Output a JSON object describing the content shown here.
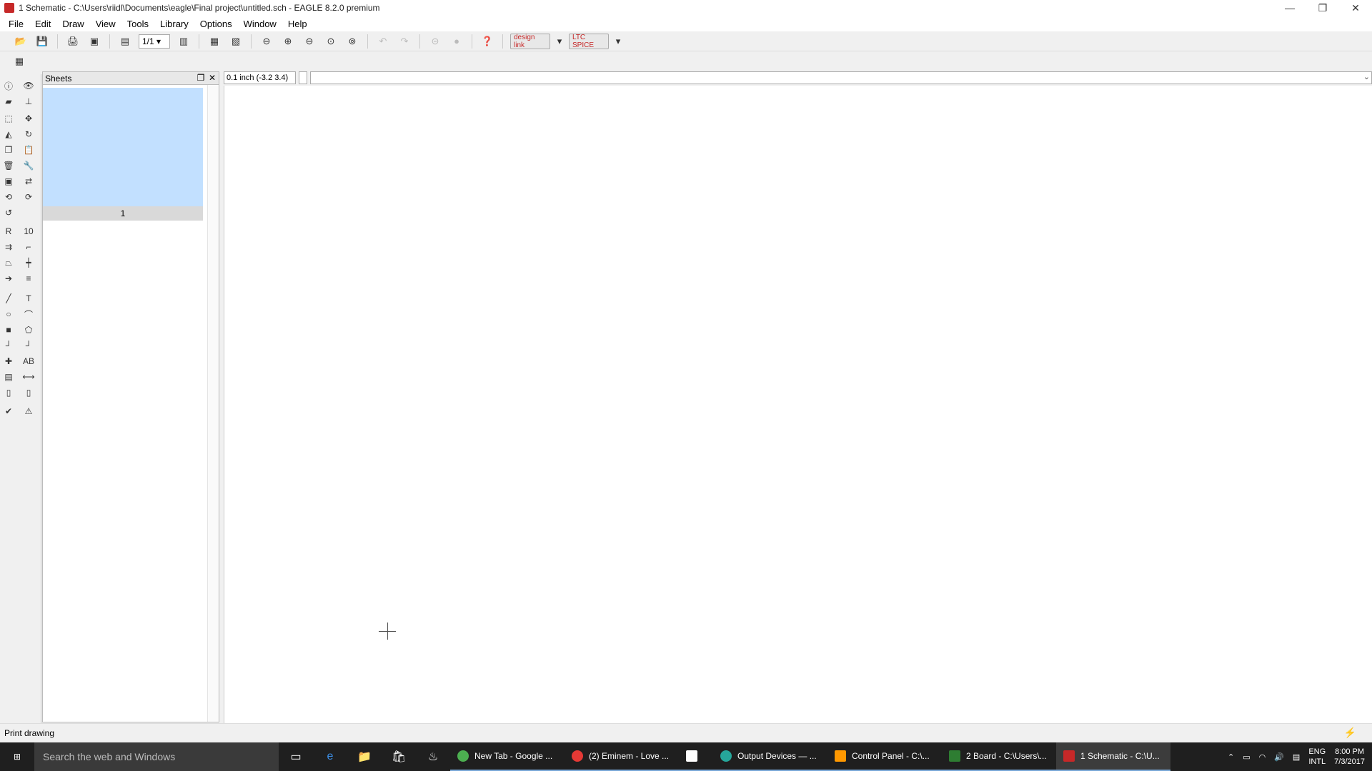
{
  "window": {
    "title": "1 Schematic - C:\\Users\\riidl\\Documents\\eagle\\Final project\\untitled.sch - EAGLE 8.2.0 premium",
    "minimize": "—",
    "restore": "❐",
    "close": "✕"
  },
  "menu": [
    "File",
    "Edit",
    "Draw",
    "View",
    "Tools",
    "Library",
    "Options",
    "Window",
    "Help"
  ],
  "toolbar": {
    "sheet_combo": "1/1",
    "design_link": "design link",
    "ltspice": "LTC SPICE"
  },
  "sheets_panel": {
    "title": "Sheets",
    "sheet_label": "1"
  },
  "coord_readout": "0.1 inch (-3.2 3.4)",
  "command_input": "",
  "status": "Print drawing",
  "taskbar": {
    "search_placeholder": "Search the web and Windows",
    "tasks": [
      {
        "label": "New Tab - Google ...",
        "color": "#4caf50"
      },
      {
        "label": "(2) Eminem - Love ...",
        "color": "#e53935"
      },
      {
        "label": "",
        "color": "#ffffff"
      },
      {
        "label": "Output Devices — ...",
        "color": "#26a69a"
      },
      {
        "label": "Control Panel - C:\\...",
        "color": "#ff9800"
      },
      {
        "label": "2 Board - C:\\Users\\...",
        "color": "#2e7d32"
      },
      {
        "label": "1 Schematic - C:\\U...",
        "color": "#c62828"
      }
    ],
    "lang": "ENG",
    "lang_sub": "INTL",
    "time": "8:00 PM",
    "date": "7/3/2017"
  },
  "colors": {
    "sheet_thumb": "#c2e0ff",
    "taskbar": "#1f1f1f",
    "active_task": "#3c3c3c"
  }
}
